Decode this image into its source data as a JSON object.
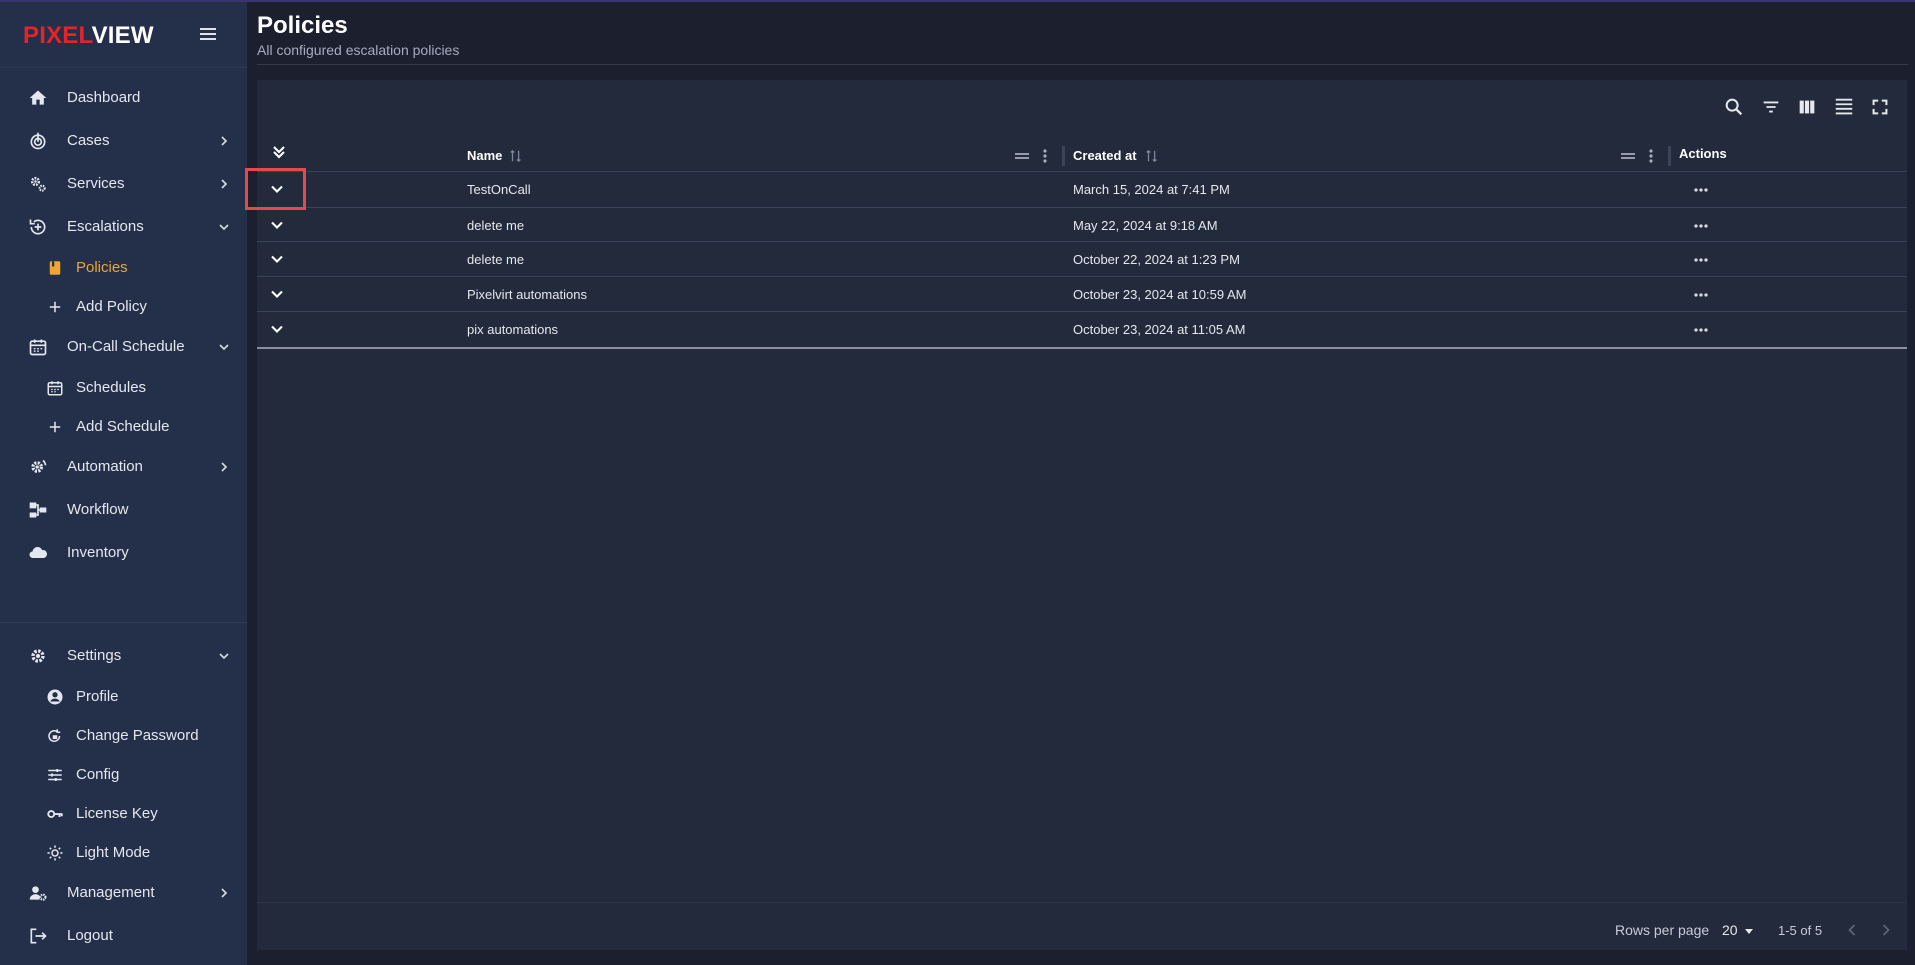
{
  "brand": {
    "part1": "PIXEL",
    "part2": "VIEW",
    "accent_color": "#e5232b"
  },
  "sidebar": {
    "items": [
      {
        "label": "Dashboard",
        "icon": "home-icon"
      },
      {
        "label": "Cases",
        "icon": "radar-icon",
        "chevron": "right"
      },
      {
        "label": "Services",
        "icon": "cogs-icon",
        "chevron": "right"
      },
      {
        "label": "Escalations",
        "icon": "escalation-icon",
        "chevron": "down",
        "children": [
          {
            "label": "Policies",
            "icon": "book-icon",
            "active": true
          },
          {
            "label": "Add Policy",
            "icon": "plus-icon"
          }
        ]
      },
      {
        "label": "On-Call Schedule",
        "icon": "calendar-icon",
        "chevron": "down",
        "children": [
          {
            "label": "Schedules",
            "icon": "calendar-icon"
          },
          {
            "label": "Add Schedule",
            "icon": "plus-icon"
          }
        ]
      },
      {
        "label": "Automation",
        "icon": "gear-refresh-icon",
        "chevron": "right"
      },
      {
        "label": "Workflow",
        "icon": "workflow-icon"
      },
      {
        "label": "Inventory",
        "icon": "cloud-icon"
      }
    ],
    "bottom_items": [
      {
        "label": "Settings",
        "icon": "gear-icon",
        "chevron": "down",
        "children": [
          {
            "label": "Profile",
            "icon": "account-circle-icon"
          },
          {
            "label": "Change Password",
            "icon": "lock-reset-icon"
          },
          {
            "label": "Config",
            "icon": "sliders-icon"
          },
          {
            "label": "License Key",
            "icon": "key-icon"
          },
          {
            "label": "Light Mode",
            "icon": "sun-icon"
          }
        ]
      },
      {
        "label": "Management",
        "icon": "user-gear-icon",
        "chevron": "right"
      },
      {
        "label": "Logout",
        "icon": "logout-icon"
      }
    ],
    "active_color": "#f0a431"
  },
  "page": {
    "title": "Policies",
    "subtitle": "All configured escalation policies"
  },
  "table": {
    "toolbar_icons": [
      "search-icon",
      "filter-icon",
      "columns-icon",
      "density-icon",
      "fullscreen-icon"
    ],
    "columns": {
      "name": "Name",
      "created_at": "Created at",
      "actions": "Actions"
    },
    "rows": [
      {
        "name": "TestOnCall",
        "created_at": "March 15, 2024 at 7:41 PM"
      },
      {
        "name": "delete me",
        "created_at": "May 22, 2024 at 9:18 AM"
      },
      {
        "name": "delete me",
        "created_at": "October 22, 2024 at 1:23 PM"
      },
      {
        "name": "Pixelvirt automations",
        "created_at": "October 23, 2024 at 10:59 AM"
      },
      {
        "name": "pix automations",
        "created_at": "October 23, 2024 at 11:05 AM"
      }
    ],
    "footer": {
      "rows_per_page_label": "Rows per page",
      "rows_per_page_value": "20",
      "range": "1-5 of 5"
    }
  },
  "highlight_color": "#e5484d"
}
